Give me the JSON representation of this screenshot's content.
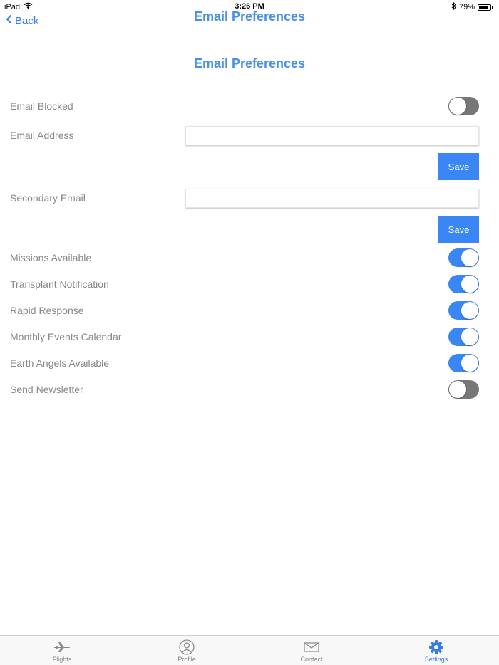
{
  "status_bar": {
    "carrier": "iPad",
    "time": "3:26 PM",
    "battery": "79%"
  },
  "nav": {
    "back_label": "Back",
    "title": "Email Preferences"
  },
  "page": {
    "heading": "Email Preferences"
  },
  "rows": {
    "email_blocked": {
      "label": "Email Blocked",
      "on": false
    },
    "email_address": {
      "label": "Email Address",
      "value": "",
      "save_label": "Save"
    },
    "secondary_email": {
      "label": "Secondary Email",
      "value": "",
      "save_label": "Save"
    },
    "missions_available": {
      "label": "Missions Available",
      "on": true
    },
    "transplant_notification": {
      "label": "Transplant Notification",
      "on": true
    },
    "rapid_response": {
      "label": "Rapid Response",
      "on": true
    },
    "monthly_events_calendar": {
      "label": "Monthly Events Calendar",
      "on": true
    },
    "earth_angels_available": {
      "label": "Earth Angels Available",
      "on": true
    },
    "send_newsletter": {
      "label": "Send Newsletter",
      "on": false
    }
  },
  "tabs": [
    {
      "label": "Flights",
      "icon": "airplane-icon",
      "active": false
    },
    {
      "label": "Profile",
      "icon": "person-icon",
      "active": false
    },
    {
      "label": "Contact",
      "icon": "envelope-icon",
      "active": false
    },
    {
      "label": "Settings",
      "icon": "gear-icon",
      "active": true
    }
  ],
  "colors": {
    "accent": "#3a86f5",
    "title": "#4a90e2",
    "label": "#888888",
    "toggle_off": "#777777"
  }
}
